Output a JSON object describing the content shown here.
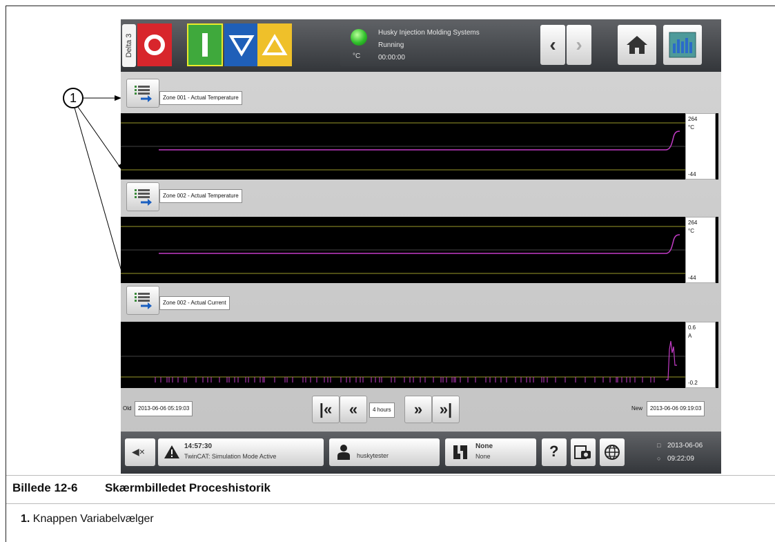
{
  "delta_tab": "Delta 3",
  "status": {
    "company": "Husky Injection Molding Systems",
    "state": "Running",
    "timer": "00:00:00",
    "unit": "°C"
  },
  "trends": [
    {
      "label": "Zone 001 - Actual Temperature",
      "max": "264",
      "unit": "°C",
      "min": "-44"
    },
    {
      "label": "Zone 002 - Actual Temperature",
      "max": "264",
      "unit": "°C",
      "min": "-44"
    },
    {
      "label": "Zone 002 - Actual Current",
      "max": "0.6",
      "unit": "A",
      "min": "-0.2"
    }
  ],
  "time_nav": {
    "old_label": "Old",
    "old_value": "2013-06-06 05:19:03",
    "new_label": "New",
    "new_value": "2013-06-06 09:19:03",
    "range": "4 hours"
  },
  "bottom_bar": {
    "alarm_time": "14:57:30",
    "alarm_message": "TwinCAT: Simulation Mode Active",
    "user": "huskytester",
    "mold_line1": "None",
    "mold_line2": "None",
    "date": "2013-06-06",
    "time": "09:22:09"
  },
  "callout_number": "1",
  "caption": {
    "figure_label": "Billede 12-6",
    "figure_title": "Skærmbilledet Proceshistorik",
    "item_number": "1.",
    "item_text": "Knappen Variabelvælger"
  }
}
